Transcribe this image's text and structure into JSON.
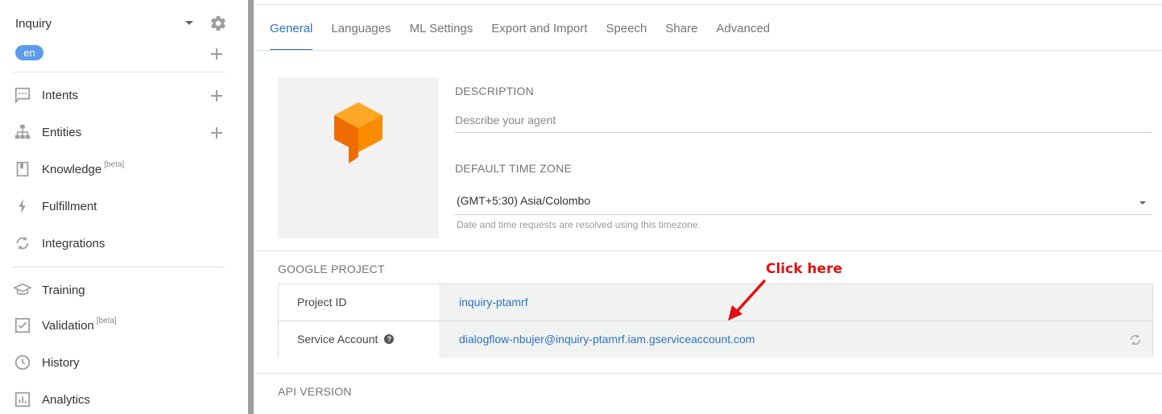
{
  "sidebar": {
    "agent_name": "Inquiry",
    "language": "en",
    "items": [
      {
        "label": "Intents",
        "icon": "chat-icon",
        "beta": ""
      },
      {
        "label": "Entities",
        "icon": "hierarchy-icon",
        "beta": ""
      },
      {
        "label": "Knowledge",
        "icon": "book-icon",
        "beta": "[beta]"
      },
      {
        "label": "Fulfillment",
        "icon": "bolt-icon",
        "beta": ""
      },
      {
        "label": "Integrations",
        "icon": "sync-icon",
        "beta": ""
      },
      {
        "label": "Training",
        "icon": "graduation-cap-icon",
        "beta": ""
      },
      {
        "label": "Validation",
        "icon": "check-box-icon",
        "beta": "[beta]"
      },
      {
        "label": "History",
        "icon": "clock-icon",
        "beta": ""
      },
      {
        "label": "Analytics",
        "icon": "bar-chart-icon",
        "beta": ""
      }
    ]
  },
  "tabs": [
    {
      "label": "General",
      "active": true
    },
    {
      "label": "Languages",
      "active": false
    },
    {
      "label": "ML Settings",
      "active": false
    },
    {
      "label": "Export and Import",
      "active": false
    },
    {
      "label": "Speech",
      "active": false
    },
    {
      "label": "Share",
      "active": false
    },
    {
      "label": "Advanced",
      "active": false
    }
  ],
  "general": {
    "description_label": "DESCRIPTION",
    "description_placeholder": "Describe your agent",
    "timezone_label": "DEFAULT TIME ZONE",
    "timezone_value": "(GMT+5:30) Asia/Colombo",
    "timezone_hint": "Date and time requests are resolved using this timezone."
  },
  "google_project": {
    "label": "GOOGLE PROJECT",
    "project_id_key": "Project ID",
    "project_id_value": "inquiry-ptamrf",
    "service_account_key": "Service Account",
    "service_account_value": "dialogflow-nbujer@inquiry-ptamrf.iam.gserviceaccount.com"
  },
  "api_version_label": "API VERSION",
  "annotation": "Click here",
  "colors": {
    "accent": "#2b74bf",
    "badge": "#5d9cec",
    "annotation": "#e01010",
    "logo_orange": "#ff8f00"
  }
}
